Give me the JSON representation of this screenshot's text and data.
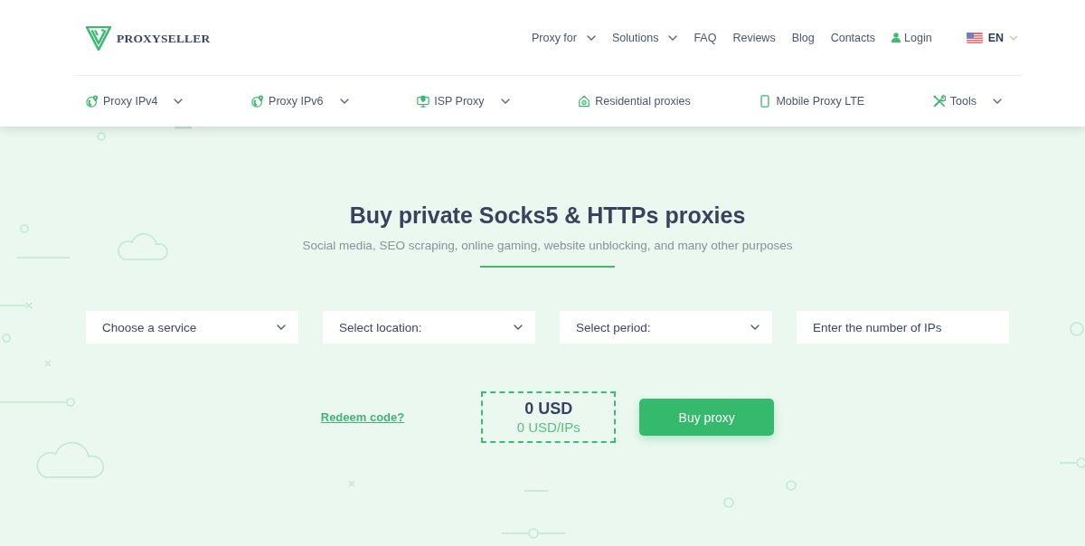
{
  "logo": {
    "text": "PROXYSELLER"
  },
  "top_nav": [
    {
      "label": "Proxy for",
      "has_menu": true
    },
    {
      "label": "Solutions",
      "has_menu": true
    },
    {
      "label": "FAQ",
      "has_menu": false
    },
    {
      "label": "Reviews",
      "has_menu": false
    },
    {
      "label": "Blog",
      "has_menu": false
    },
    {
      "label": "Contacts",
      "has_menu": false
    }
  ],
  "login": {
    "label": "Login"
  },
  "language": {
    "code": "EN"
  },
  "categories": [
    {
      "label": "Proxy IPv4",
      "has_menu": true
    },
    {
      "label": "Proxy IPv6",
      "has_menu": true
    },
    {
      "label": "ISP Proxy",
      "has_menu": true
    },
    {
      "label": "Residential proxies",
      "has_menu": false
    },
    {
      "label": "Mobile Proxy LTE",
      "has_menu": false
    },
    {
      "label": "Tools",
      "has_menu": true
    }
  ],
  "hero": {
    "title": "Buy private Socks5 & HTTPs proxies",
    "subtitle": "Social media, SEO scraping, online gaming, website unblocking, and many other purposes"
  },
  "order_form": {
    "fields": [
      {
        "kind": "select",
        "value": "Choose a service"
      },
      {
        "kind": "select",
        "value": "Select location:"
      },
      {
        "kind": "select",
        "value": "Select period:"
      },
      {
        "kind": "input",
        "placeholder": "Enter the number of IPs"
      }
    ],
    "redeem_link": "Redeem code?",
    "total": "0 USD",
    "unit_price": "0 USD/IPs",
    "buy_button": "Buy proxy"
  }
}
